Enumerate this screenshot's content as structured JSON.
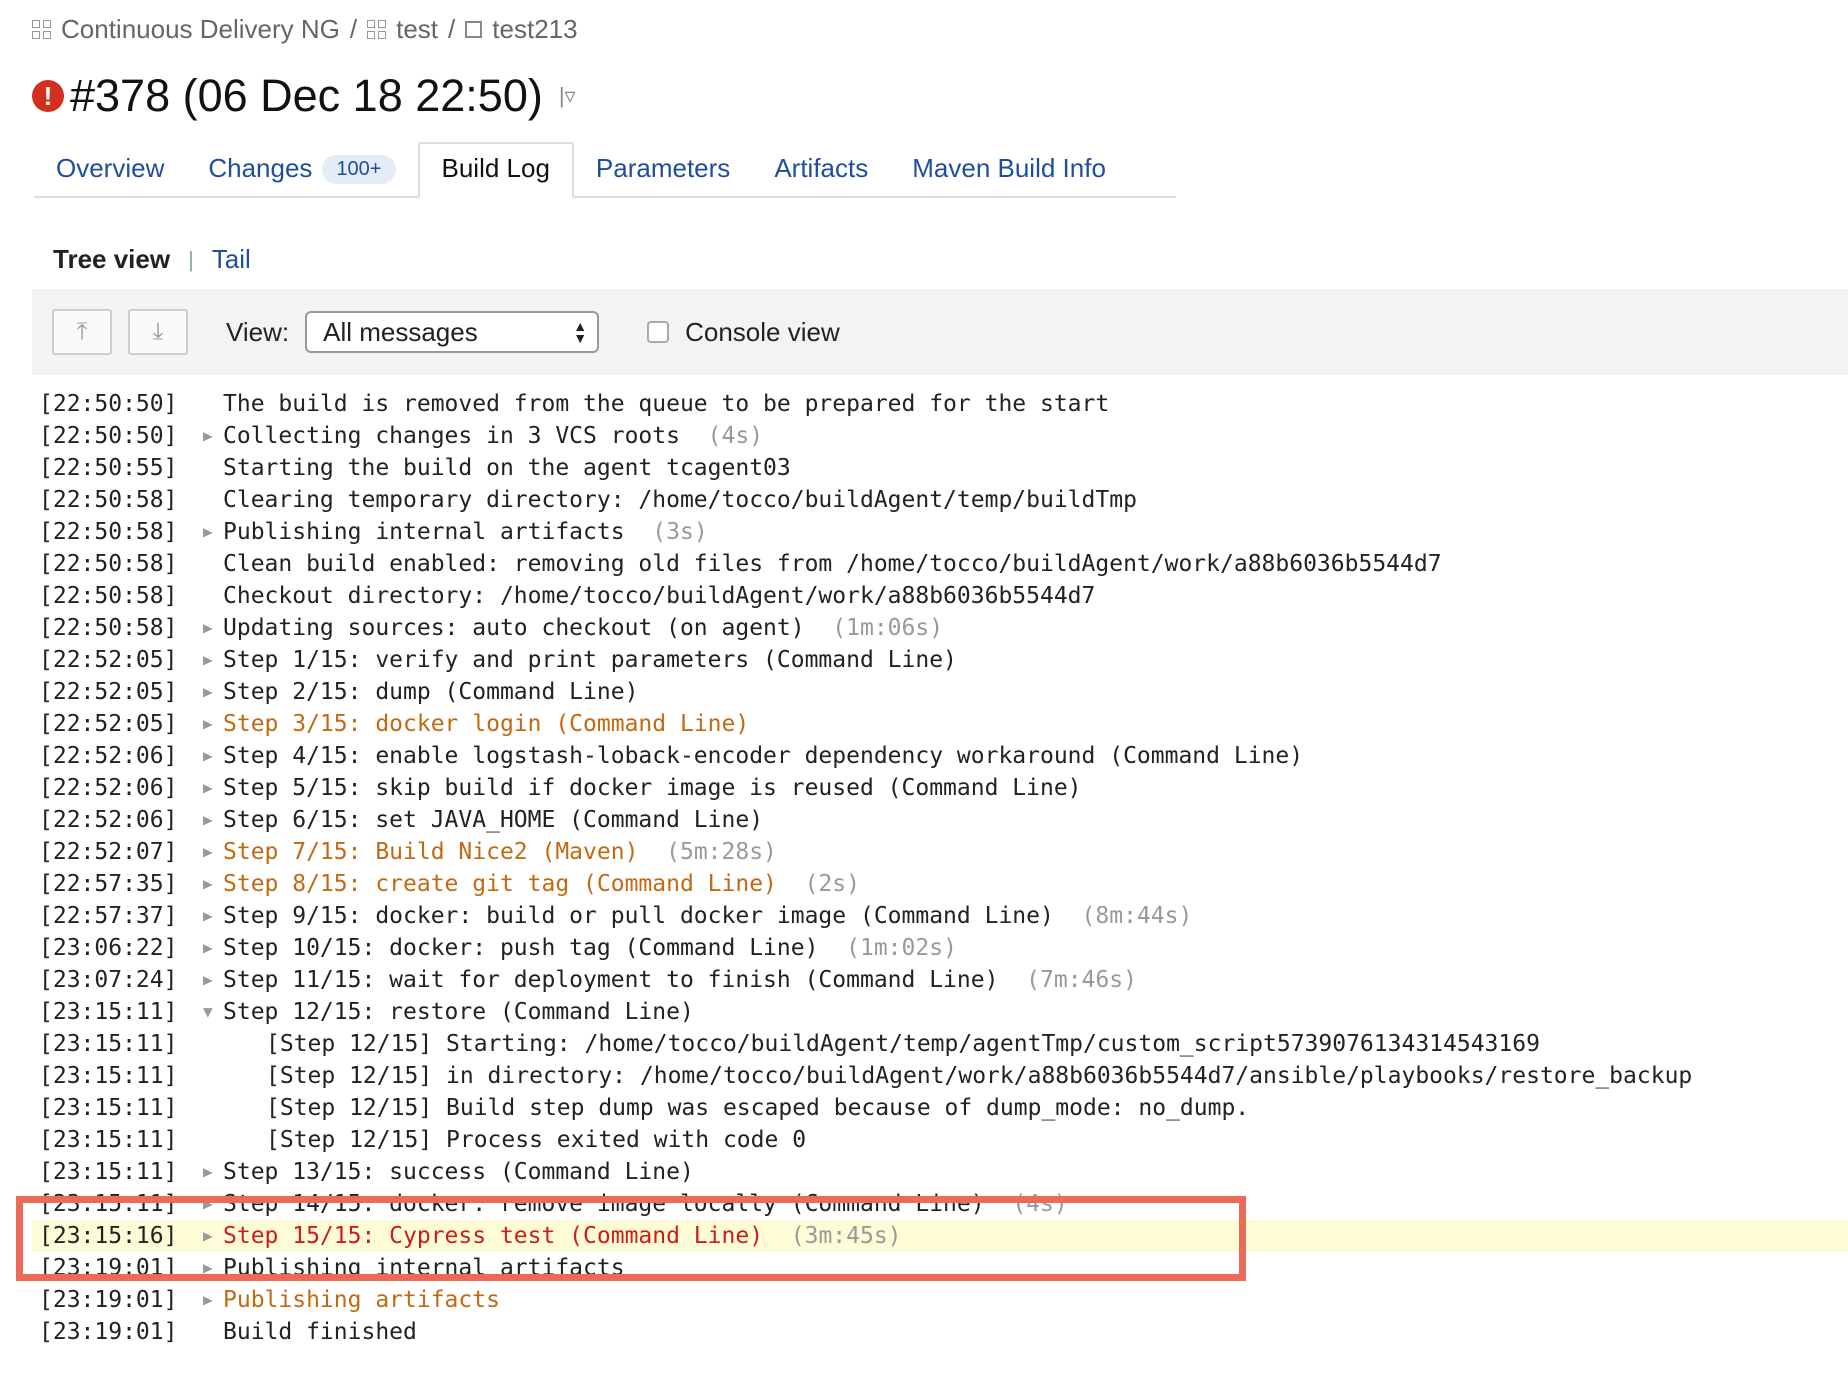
{
  "breadcrumb": [
    {
      "label": "Continuous Delivery NG",
      "icon": "project-grid-icon"
    },
    {
      "label": "test",
      "icon": "project-grid-icon"
    },
    {
      "label": "test213",
      "icon": "build-config-icon"
    }
  ],
  "breadcrumb_sep": "/",
  "title": "#378 (06 Dec 18 22:50)",
  "status": "failed",
  "tabs": [
    {
      "label": "Overview"
    },
    {
      "label": "Changes",
      "badge": "100+"
    },
    {
      "label": "Build Log",
      "active": true
    },
    {
      "label": "Parameters"
    },
    {
      "label": "Artifacts"
    },
    {
      "label": "Maven Build Info"
    }
  ],
  "subnav": {
    "tree": "Tree view",
    "sep": "|",
    "tail": "Tail"
  },
  "toolbar": {
    "view_label": "View:",
    "view_value": "All messages",
    "console_label": "Console view",
    "console_checked": false
  },
  "colors": {
    "warning": "#c16a12",
    "error": "#cc1d1d",
    "highlight": "#fefcd6",
    "annotation_box": "#ec6a58"
  },
  "log": [
    {
      "ts": "[22:50:50]",
      "text": "The build is removed from the queue to be prepared for the start"
    },
    {
      "ts": "[22:50:50]",
      "exp": "collapsed",
      "text": "Collecting changes in 3 VCS roots",
      "dur": "(4s)"
    },
    {
      "ts": "[22:50:55]",
      "text": "Starting the build on the agent tcagent03"
    },
    {
      "ts": "[22:50:58]",
      "text": "Clearing temporary directory: /home/tocco/buildAgent/temp/buildTmp"
    },
    {
      "ts": "[22:50:58]",
      "exp": "collapsed",
      "text": "Publishing internal artifacts",
      "dur": "(3s)"
    },
    {
      "ts": "[22:50:58]",
      "text": "Clean build enabled: removing old files from /home/tocco/buildAgent/work/a88b6036b5544d7"
    },
    {
      "ts": "[22:50:58]",
      "text": "Checkout directory: /home/tocco/buildAgent/work/a88b6036b5544d7"
    },
    {
      "ts": "[22:50:58]",
      "exp": "collapsed",
      "text": "Updating sources: auto checkout (on agent)",
      "dur": "(1m:06s)"
    },
    {
      "ts": "[22:52:05]",
      "exp": "collapsed",
      "text": "Step 1/15: verify and print parameters (Command Line)"
    },
    {
      "ts": "[22:52:05]",
      "exp": "collapsed",
      "text": "Step 2/15: dump (Command Line)"
    },
    {
      "ts": "[22:52:05]",
      "exp": "collapsed",
      "text": "Step 3/15: docker login (Command Line)",
      "level": "warn"
    },
    {
      "ts": "[22:52:06]",
      "exp": "collapsed",
      "text": "Step 4/15: enable logstash-loback-encoder dependency workaround (Command Line)"
    },
    {
      "ts": "[22:52:06]",
      "exp": "collapsed",
      "text": "Step 5/15: skip build if docker image is reused (Command Line)"
    },
    {
      "ts": "[22:52:06]",
      "exp": "collapsed",
      "text": "Step 6/15: set JAVA_HOME (Command Line)"
    },
    {
      "ts": "[22:52:07]",
      "exp": "collapsed",
      "text": "Step 7/15: Build Nice2 (Maven)",
      "dur": "(5m:28s)",
      "level": "warn"
    },
    {
      "ts": "[22:57:35]",
      "exp": "collapsed",
      "text": "Step 8/15: create git tag (Command Line)",
      "dur": "(2s)",
      "level": "warn"
    },
    {
      "ts": "[22:57:37]",
      "exp": "collapsed",
      "text": "Step 9/15: docker: build or pull docker image (Command Line)",
      "dur": "(8m:44s)"
    },
    {
      "ts": "[23:06:22]",
      "exp": "collapsed",
      "text": "Step 10/15: docker: push tag (Command Line)",
      "dur": "(1m:02s)"
    },
    {
      "ts": "[23:07:24]",
      "exp": "collapsed",
      "text": "Step 11/15: wait for deployment to finish (Command Line)",
      "dur": "(7m:46s)"
    },
    {
      "ts": "[23:15:11]",
      "exp": "expanded",
      "text": "Step 12/15: restore (Command Line)"
    },
    {
      "ts": "[23:15:11]",
      "indent": true,
      "text": "[Step 12/15] Starting: /home/tocco/buildAgent/temp/agentTmp/custom_script5739076134314543169"
    },
    {
      "ts": "[23:15:11]",
      "indent": true,
      "text": "[Step 12/15] in directory: /home/tocco/buildAgent/work/a88b6036b5544d7/ansible/playbooks/restore_backup"
    },
    {
      "ts": "[23:15:11]",
      "indent": true,
      "text": "[Step 12/15] Build step dump was escaped because of dump_mode: no_dump."
    },
    {
      "ts": "[23:15:11]",
      "indent": true,
      "text": "[Step 12/15] Process exited with code 0"
    },
    {
      "ts": "[23:15:11]",
      "exp": "collapsed",
      "text": "Step 13/15: success (Command Line)"
    },
    {
      "ts": "[23:15:11]",
      "exp": "collapsed",
      "text": "Step 14/15: docker: remove image locally (Command Line)",
      "dur": "(4s)"
    },
    {
      "ts": "[23:15:16]",
      "exp": "collapsed",
      "text": "Step 15/15: Cypress test (Command Line)",
      "dur": "(3m:45s)",
      "level": "error",
      "highlight": true
    },
    {
      "ts": "[23:19:01]",
      "exp": "collapsed",
      "text": "Publishing internal artifacts"
    },
    {
      "ts": "[23:19:01]",
      "exp": "collapsed",
      "text": "Publishing artifacts",
      "level": "warn"
    },
    {
      "ts": "[23:19:01]",
      "text": "Build finished"
    }
  ]
}
